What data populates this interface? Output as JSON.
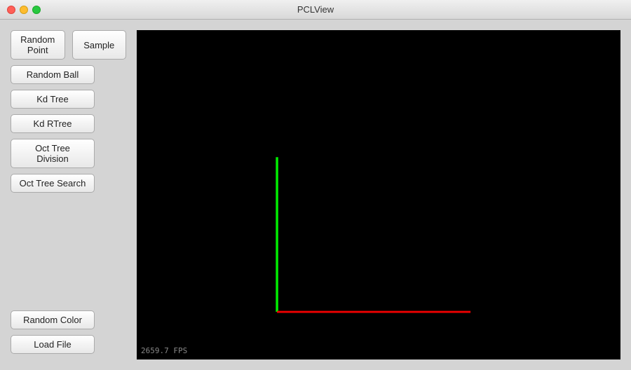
{
  "titleBar": {
    "title": "PCLView"
  },
  "buttons": {
    "randomPoint": "Random Point",
    "sample": "Sample",
    "randomBall": "Random Ball",
    "kdTree": "Kd Tree",
    "kdRTree": "Kd RTree",
    "octTreeDivision": "Oct Tree Division",
    "octTreeSearch": "Oct Tree Search",
    "randomColor": "Random Color",
    "loadFile": "Load File"
  },
  "viewport": {
    "fps": "2659.7 FPS"
  }
}
